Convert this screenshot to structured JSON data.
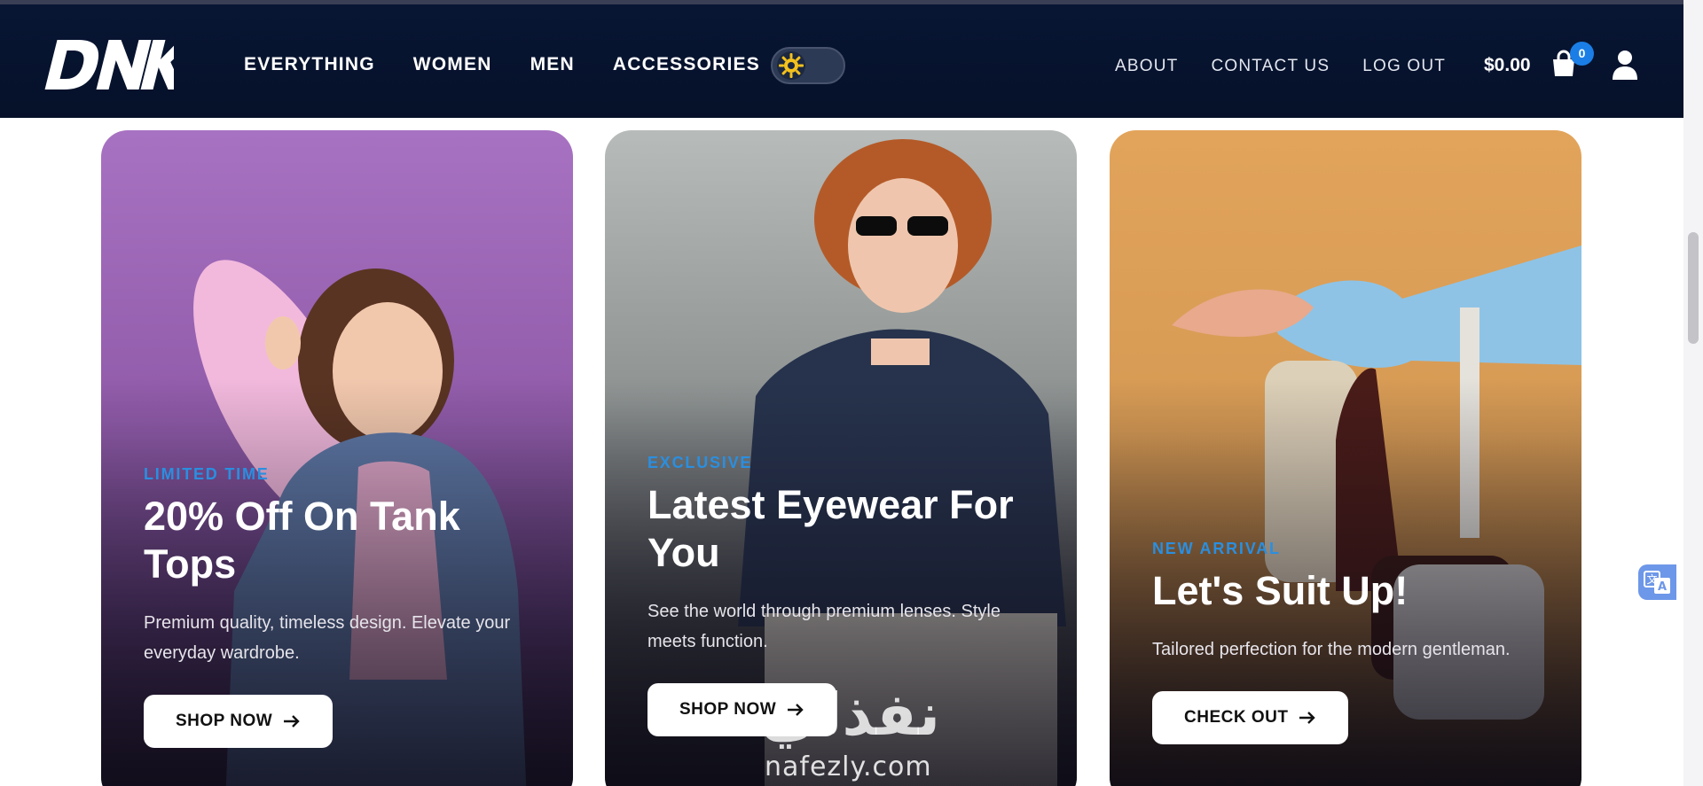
{
  "header": {
    "logo": "DNK",
    "nav_main": [
      "EVERYTHING",
      "WOMEN",
      "MEN",
      "ACCESSORIES"
    ],
    "nav_right": [
      "ABOUT",
      "CONTACT US",
      "LOG OUT"
    ],
    "cart_total": "$0.00",
    "cart_count": "0",
    "theme_icon": "sun-icon",
    "cart_icon": "shopping-bag-icon",
    "user_icon": "user-icon"
  },
  "cards": [
    {
      "tag": "LIMITED TIME",
      "title": "20% Off On Tank Tops",
      "description": "Premium quality, timeless design. Elevate your everyday wardrobe.",
      "button": "SHOP NOW"
    },
    {
      "tag": "EXCLUSIVE",
      "title": "Latest Eyewear For You",
      "description": "See the world through premium lenses. Style meets function.",
      "button": "SHOP NOW"
    },
    {
      "tag": "NEW ARRIVAL",
      "title": "Let's Suit Up!",
      "description": "Tailored perfection for the modern gentleman.",
      "button": "CHECK OUT"
    }
  ],
  "watermark": {
    "arabic": "نفذلي",
    "latin": "nafezly.com"
  },
  "colors": {
    "header_bg": "#061129",
    "accent_blue": "#2a8fe0",
    "badge_blue": "#1a7ee6"
  }
}
